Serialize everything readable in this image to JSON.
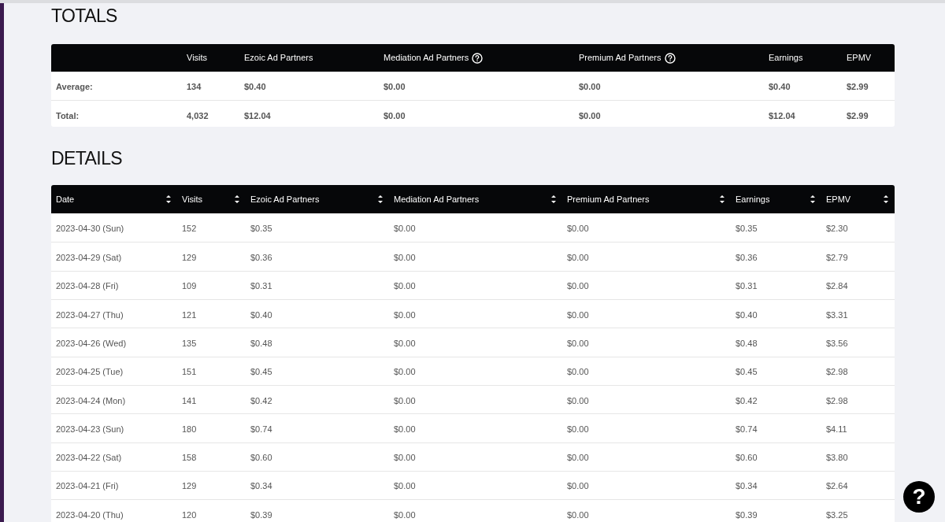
{
  "totals": {
    "title": "TOTALS",
    "columns": [
      {
        "help": false
      },
      {
        "label": "Visits",
        "help": false
      },
      {
        "label": "Ezoic Ad Partners",
        "help": false
      },
      {
        "label": "Mediation Ad Partners",
        "help": true
      },
      {
        "label": "Premium Ad Partners",
        "help": true
      },
      {
        "label": "Earnings",
        "help": false
      },
      {
        "label": "EPMV",
        "help": false
      }
    ],
    "rows": [
      [
        "Average:",
        "134",
        "$0.40",
        "$0.00",
        "$0.00",
        "$0.40",
        "$2.99"
      ],
      [
        "Total:",
        "4,032",
        "$12.04",
        "$0.00",
        "$0.00",
        "$12.04",
        "$2.99"
      ]
    ]
  },
  "details": {
    "title": "DETAILS",
    "columns": [
      "Date",
      "Visits",
      "Ezoic Ad Partners",
      "Mediation Ad Partners",
      "Premium Ad Partners",
      "Earnings",
      "EPMV"
    ],
    "rows": [
      [
        "2023-04-30 (Sun)",
        "152",
        "$0.35",
        "$0.00",
        "$0.00",
        "$0.35",
        "$2.30"
      ],
      [
        "2023-04-29 (Sat)",
        "129",
        "$0.36",
        "$0.00",
        "$0.00",
        "$0.36",
        "$2.79"
      ],
      [
        "2023-04-28 (Fri)",
        "109",
        "$0.31",
        "$0.00",
        "$0.00",
        "$0.31",
        "$2.84"
      ],
      [
        "2023-04-27 (Thu)",
        "121",
        "$0.40",
        "$0.00",
        "$0.00",
        "$0.40",
        "$3.31"
      ],
      [
        "2023-04-26 (Wed)",
        "135",
        "$0.48",
        "$0.00",
        "$0.00",
        "$0.48",
        "$3.56"
      ],
      [
        "2023-04-25 (Tue)",
        "151",
        "$0.45",
        "$0.00",
        "$0.00",
        "$0.45",
        "$2.98"
      ],
      [
        "2023-04-24 (Mon)",
        "141",
        "$0.42",
        "$0.00",
        "$0.00",
        "$0.42",
        "$2.98"
      ],
      [
        "2023-04-23 (Sun)",
        "180",
        "$0.74",
        "$0.00",
        "$0.00",
        "$0.74",
        "$4.11"
      ],
      [
        "2023-04-22 (Sat)",
        "158",
        "$0.60",
        "$0.00",
        "$0.00",
        "$0.60",
        "$3.80"
      ],
      [
        "2023-04-21 (Fri)",
        "129",
        "$0.34",
        "$0.00",
        "$0.00",
        "$0.34",
        "$2.64"
      ],
      [
        "2023-04-20 (Thu)",
        "120",
        "$0.39",
        "$0.00",
        "$0.00",
        "$0.39",
        "$3.25"
      ]
    ]
  },
  "help_button": {
    "label": "?"
  }
}
